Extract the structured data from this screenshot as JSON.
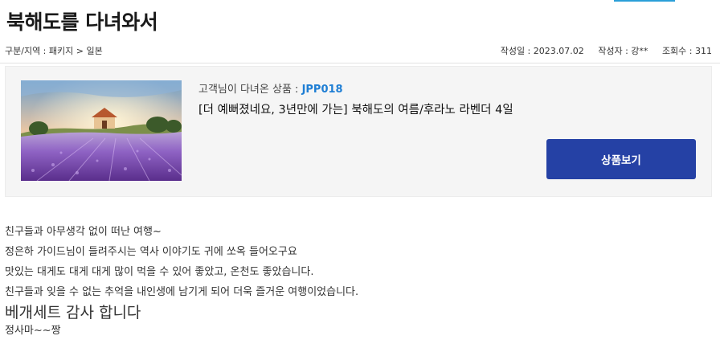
{
  "post": {
    "title": "북해도를 다녀와서",
    "category": "구분/지역 : 패키지 > 일본",
    "date": "작성일 : 2023.07.02",
    "author": "작성자 : 강**",
    "views": "조회수 : 311"
  },
  "product": {
    "prefix": "고객님이 다녀온 상품 : ",
    "code": "JPP018",
    "name": "[더 예뻐졌네요, 3년만에 가는] 북해도의 여름/후라노 라벤더 4일",
    "button_label": "상품보기",
    "image_alt": "lavender-field-photo"
  },
  "review": {
    "lines": [
      "친구들과 아무생각  없이 떠난 여행~",
      "정은하 가이드님이 들려주시는 역사 이야기도 귀에 쏘옥 들어오구요",
      "맛있는 대게도 대게 대게 많이  먹을 수 있어 좋았고, 온천도 좋았습니다.",
      "친구들과 잊을  수 없는 추억을 내인생에 남기게 되어 더욱 즐거운 여행이었습니다.",
      "베개세트 감사 합니다",
      "정사마~~짱"
    ]
  },
  "colors": {
    "accent": "#1e7ed4",
    "button": "#2541a5",
    "top_bar": "#2a9fd8"
  }
}
